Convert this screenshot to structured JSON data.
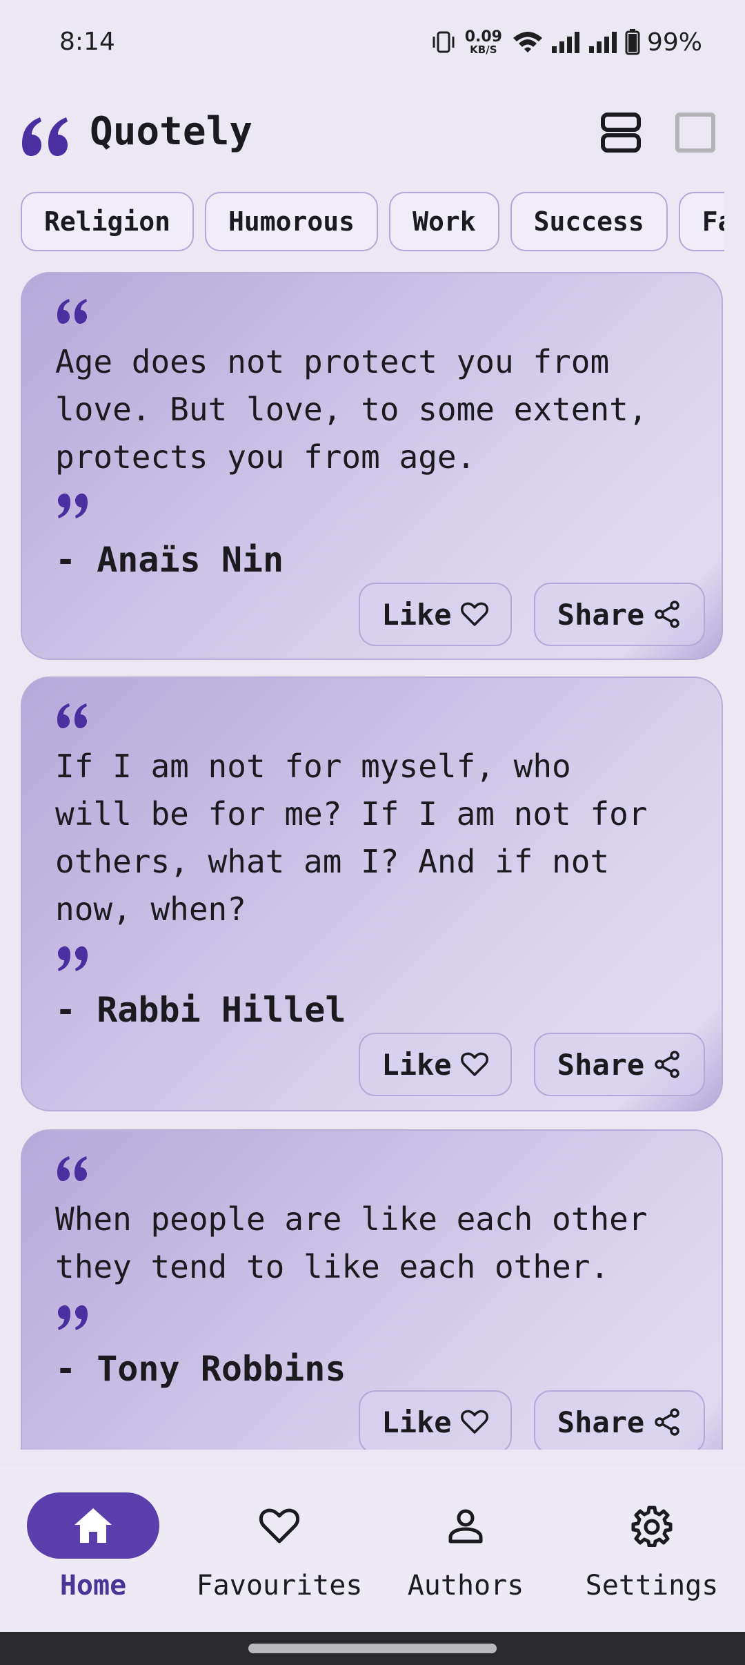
{
  "status_bar": {
    "time": "8:14",
    "net_speed_value": "0.09",
    "net_speed_unit": "KB/S",
    "battery_percent": "99%"
  },
  "header": {
    "title": "Quotely",
    "logo_icon": "quote-mark-icon",
    "actions": [
      "list-view-icon",
      "single-view-icon"
    ]
  },
  "chips": [
    "Religion",
    "Humorous",
    "Work",
    "Success",
    "Family"
  ],
  "quotes": [
    {
      "text": "Age does not protect you from\nlove. But love, to some extent,\nprotects you from age.",
      "author": "- Anaïs Nin",
      "like_label": "Like",
      "share_label": "Share"
    },
    {
      "text": "If I am not for myself, who\nwill be for me? If I am not for\nothers, what am I? And if not\nnow, when?",
      "author": "- Rabbi Hillel",
      "like_label": "Like",
      "share_label": "Share"
    },
    {
      "text": "When people are like each other\nthey tend to like each other.",
      "author": "- Tony Robbins",
      "like_label": "Like",
      "share_label": "Share"
    }
  ],
  "bottom_nav": [
    {
      "label": "Home",
      "icon": "home-icon",
      "active": true
    },
    {
      "label": "Favourites",
      "icon": "heart-icon",
      "active": false
    },
    {
      "label": "Authors",
      "icon": "person-icon",
      "active": false
    },
    {
      "label": "Settings",
      "icon": "gear-icon",
      "active": false
    }
  ],
  "colors": {
    "accent": "#5a3fac",
    "quote_mark": "#4a2fa0",
    "background": "#ebe8f4",
    "card_border": "#b7add9"
  }
}
